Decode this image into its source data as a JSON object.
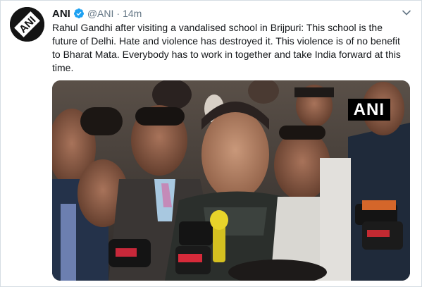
{
  "tweet": {
    "avatar_icon": "ani-logo-icon",
    "display_name": "ANI",
    "verified_icon": "verified-badge-icon",
    "handle": "@ANI",
    "separator": "·",
    "timestamp": "14m",
    "menu_icon": "chevron-down-icon",
    "text": "Rahul Gandhi after visiting a vandalised school in Brijpuri: This school is the future of Delhi. Hate and violence has destroyed it. This violence is of no benefit to Bharat Mata. Everybody has to work in together and take India forward at this time.",
    "media": {
      "watermark": "ANI"
    }
  },
  "colors": {
    "text_primary": "#14171a",
    "text_secondary": "#657786",
    "verified_blue": "#1da1f2"
  }
}
